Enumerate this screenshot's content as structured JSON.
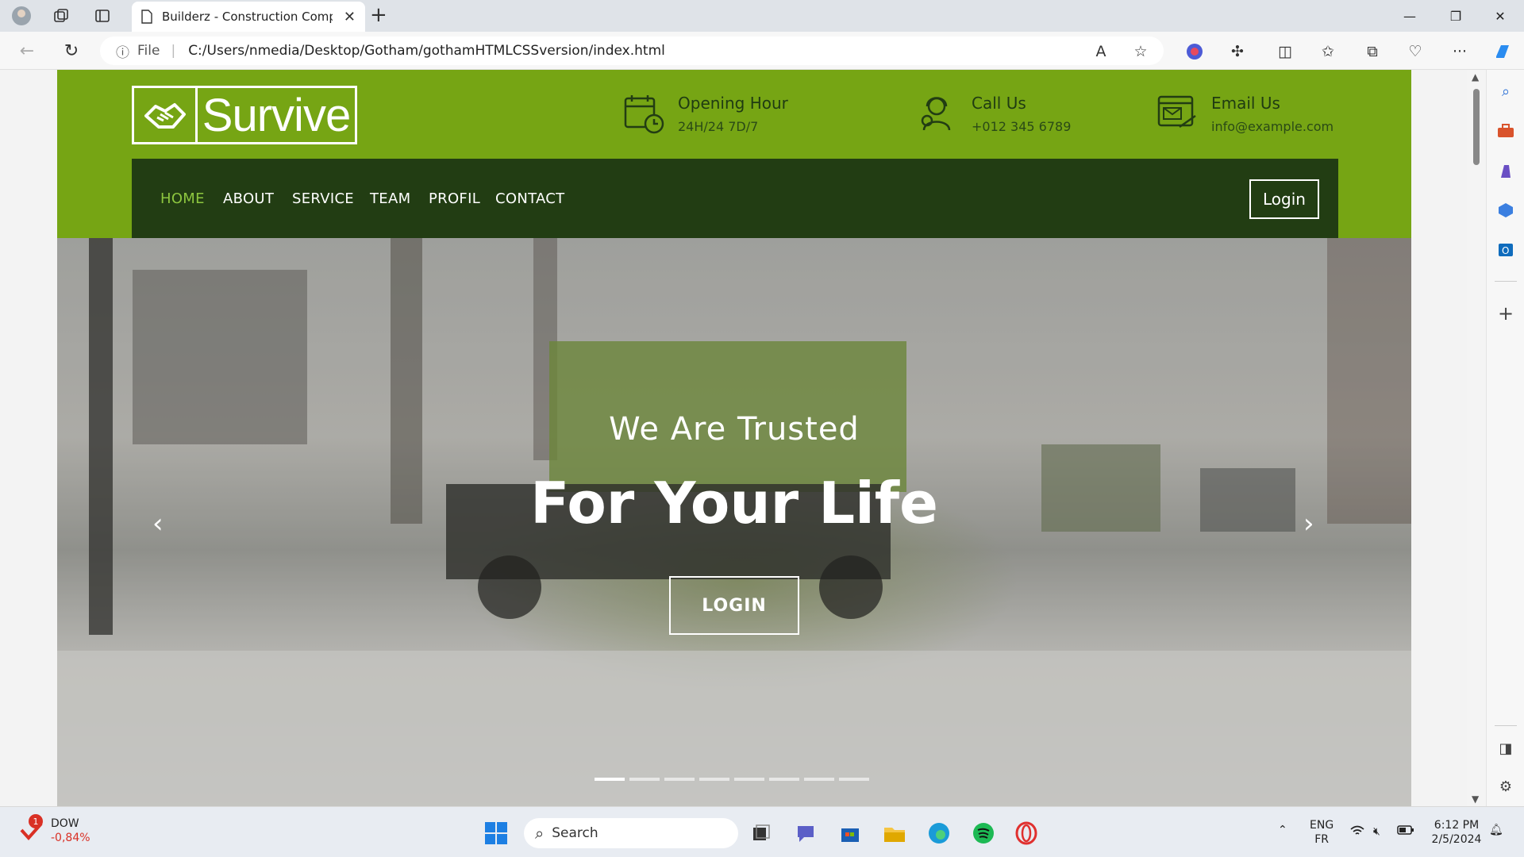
{
  "browser": {
    "tab_title": "Builderz - Construction Company",
    "url_prefix": "File",
    "url": "C:/Users/nmedia/Desktop/Gotham/gothamHTMLCSSversion/index.html"
  },
  "site": {
    "logo_text": "Survive",
    "info": [
      {
        "title": "Opening Hour",
        "value": "24H/24 7D/7"
      },
      {
        "title": "Call Us",
        "value": "+012 345 6789"
      },
      {
        "title": "Email Us",
        "value": "info@example.com"
      }
    ],
    "nav": [
      "HOME",
      "ABOUT",
      "SERVICE",
      "TEAM",
      "PROFIL",
      "CONTACT"
    ],
    "login_label": "Login",
    "hero": {
      "subtitle": "We Are Trusted",
      "title": "For Your Life",
      "button": "LOGIN",
      "slide_count": 8,
      "active_slide": 1
    },
    "colors": {
      "topbar": "#76a514",
      "navbar": "#223d13",
      "active_nav": "#8dc63f"
    }
  },
  "taskbar": {
    "stock_name": "DOW",
    "stock_change": "-0,84%",
    "badge": "1",
    "search_label": "Search",
    "lang_1": "ENG",
    "lang_2": "FR",
    "time": "6:12 PM",
    "date": "2/5/2024"
  }
}
